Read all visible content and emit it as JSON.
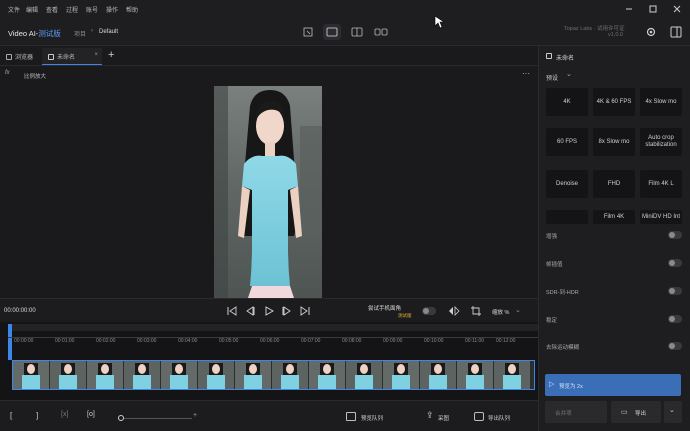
{
  "menu": {
    "items": [
      "文件",
      "编辑",
      "查看",
      "过程",
      "账号",
      "操作",
      "帮助"
    ]
  },
  "titlebar": {
    "app_title": "Video AI-",
    "app_title_suffix": "测试版",
    "breadcrumb_parent": "项目",
    "breadcrumb_current": "Default",
    "brand": "Topaz Labs · 试用许可证",
    "version": "v1.0.0"
  },
  "tabs": {
    "browse": "浏览器",
    "untitled": "未命名",
    "add": "+"
  },
  "subbar": {
    "label": "比例放大"
  },
  "controls": {
    "timecode": "00:00:00:00",
    "ai_label": "尝试手机面角",
    "ai_badge": "测试版",
    "zoom_label": "缩放 %"
  },
  "timeline": {
    "ticks": [
      "00:00:00",
      "00:01:00",
      "00:02:00",
      "00:03:00",
      "00:04:00",
      "00:05:00",
      "00:06:00",
      "00:07:00",
      "00:08:00",
      "00:09:00",
      "00:10:00",
      "00:11:00",
      "00:12:00"
    ]
  },
  "bottombar": {
    "preview_queue": "预览队列",
    "snapshot": "采图",
    "export_queue": "导出队列"
  },
  "rightpanel": {
    "title": "未命名",
    "presets_label": "预设",
    "presets": [
      "4K",
      "4K & 60 FPS",
      "4x Slow mo",
      "60 FPS",
      "8x Slow mo",
      "Auto crop stabilization",
      "Denoise",
      "FHD",
      "Film 4K L",
      "",
      "Film 4K",
      "MiniDV HD Int"
    ],
    "options": [
      "增强",
      "帧插值",
      "SDR-到-HDR",
      "稳定",
      "去除运动模糊"
    ],
    "preview_button": "预览为 2x",
    "export_left": "合并项",
    "export_right": "导出"
  },
  "colors": {
    "accent": "#3d87e8",
    "panel": "#1e1e20",
    "video_top": "#6d7371",
    "dress": "#7fd0e0"
  }
}
